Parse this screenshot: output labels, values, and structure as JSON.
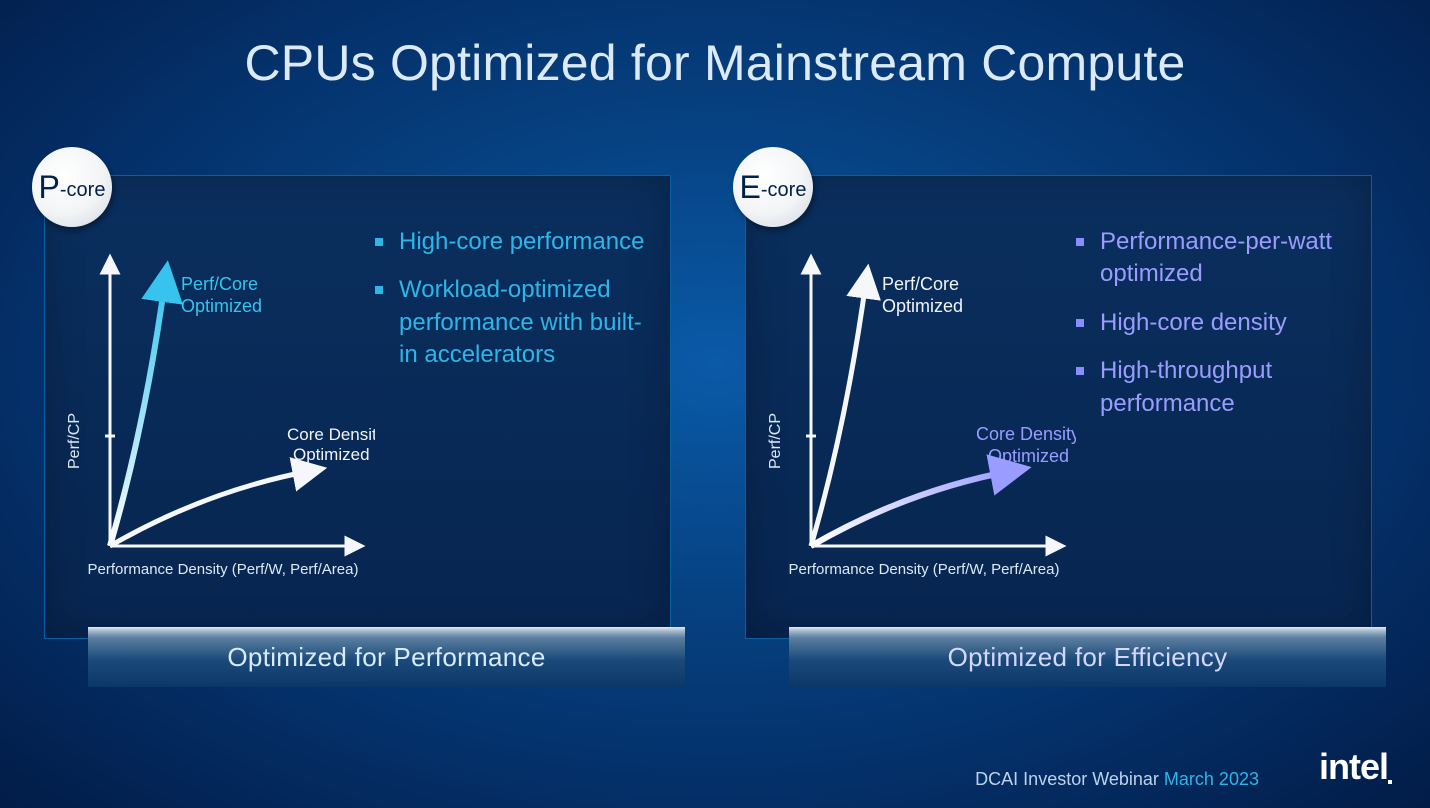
{
  "title": "CPUs Optimized for Mainstream Compute",
  "panels": {
    "p": {
      "badge_big": "P",
      "badge_small": "-core",
      "bullets": [
        "High-core performance",
        "Workload-optimized performance with built-in accelerators"
      ],
      "caption": "Optimized for Performance",
      "chart": {
        "ylabel": "Perf/CP",
        "xlabel": "Performance Density (Perf/W, Perf/Area)",
        "curve_a_label_l1": "Perf/Core",
        "curve_a_label_l2": "Optimized",
        "curve_b_label_l1": "Core Density",
        "curve_b_label_l2": "Optimized",
        "highlight": "a"
      }
    },
    "e": {
      "badge_big": "E",
      "badge_small": "-core",
      "bullets": [
        "Performance-per-watt optimized",
        "High-core density",
        "High-throughput performance"
      ],
      "caption": "Optimized for Efficiency",
      "chart": {
        "ylabel": "Perf/CP",
        "xlabel": "Performance Density (Perf/W, Perf/Area)",
        "curve_a_label_l1": "Perf/Core",
        "curve_a_label_l2": "Optimized",
        "curve_b_label_l1": "Core Density",
        "curve_b_label_l2": "Optimized",
        "highlight": "b"
      }
    }
  },
  "footer": {
    "text": "DCAI Investor Webinar ",
    "date": "March 2023",
    "logo": "intel"
  },
  "colors": {
    "p_accent": "#2fb5e8",
    "e_accent": "#9a9dff",
    "neutral_curve": "#f5f7fa"
  },
  "chart_data": [
    {
      "panel": "P-core",
      "type": "line",
      "title": "",
      "xlabel": "Performance Density (Perf/W, Perf/Area)",
      "ylabel": "Perf/CP",
      "xlim": [
        0,
        10
      ],
      "ylim": [
        0,
        10
      ],
      "grid": false,
      "note": "Conceptual trade-off curves; axes are qualitative (no numeric ticks shown). Values below are illustrative shape points inferred from the drawn curves.",
      "series": [
        {
          "name": "Perf/Core Optimized",
          "highlighted": true,
          "x": [
            0,
            0.7,
            1.2,
            1.7,
            2.1,
            2.4
          ],
          "y": [
            0,
            2.5,
            4.5,
            6.5,
            8.3,
            9.6
          ]
        },
        {
          "name": "Core Density Optimized",
          "highlighted": false,
          "x": [
            0,
            1.5,
            3.0,
            4.5,
            6.0,
            7.2
          ],
          "y": [
            0,
            1.2,
            1.9,
            2.4,
            2.8,
            3.1
          ]
        }
      ]
    },
    {
      "panel": "E-core",
      "type": "line",
      "title": "",
      "xlabel": "Performance Density (Perf/W, Perf/Area)",
      "ylabel": "Perf/CP",
      "xlim": [
        0,
        10
      ],
      "ylim": [
        0,
        10
      ],
      "grid": false,
      "note": "Conceptual trade-off curves; axes are qualitative (no numeric ticks shown). Values below are illustrative shape points inferred from the drawn curves.",
      "series": [
        {
          "name": "Perf/Core Optimized",
          "highlighted": false,
          "x": [
            0,
            0.7,
            1.2,
            1.7,
            2.1,
            2.4
          ],
          "y": [
            0,
            2.5,
            4.5,
            6.5,
            8.3,
            9.6
          ]
        },
        {
          "name": "Core Density Optimized",
          "highlighted": true,
          "x": [
            0,
            1.5,
            3.0,
            4.5,
            6.0,
            7.2
          ],
          "y": [
            0,
            1.2,
            1.9,
            2.4,
            2.8,
            3.1
          ]
        }
      ]
    }
  ]
}
